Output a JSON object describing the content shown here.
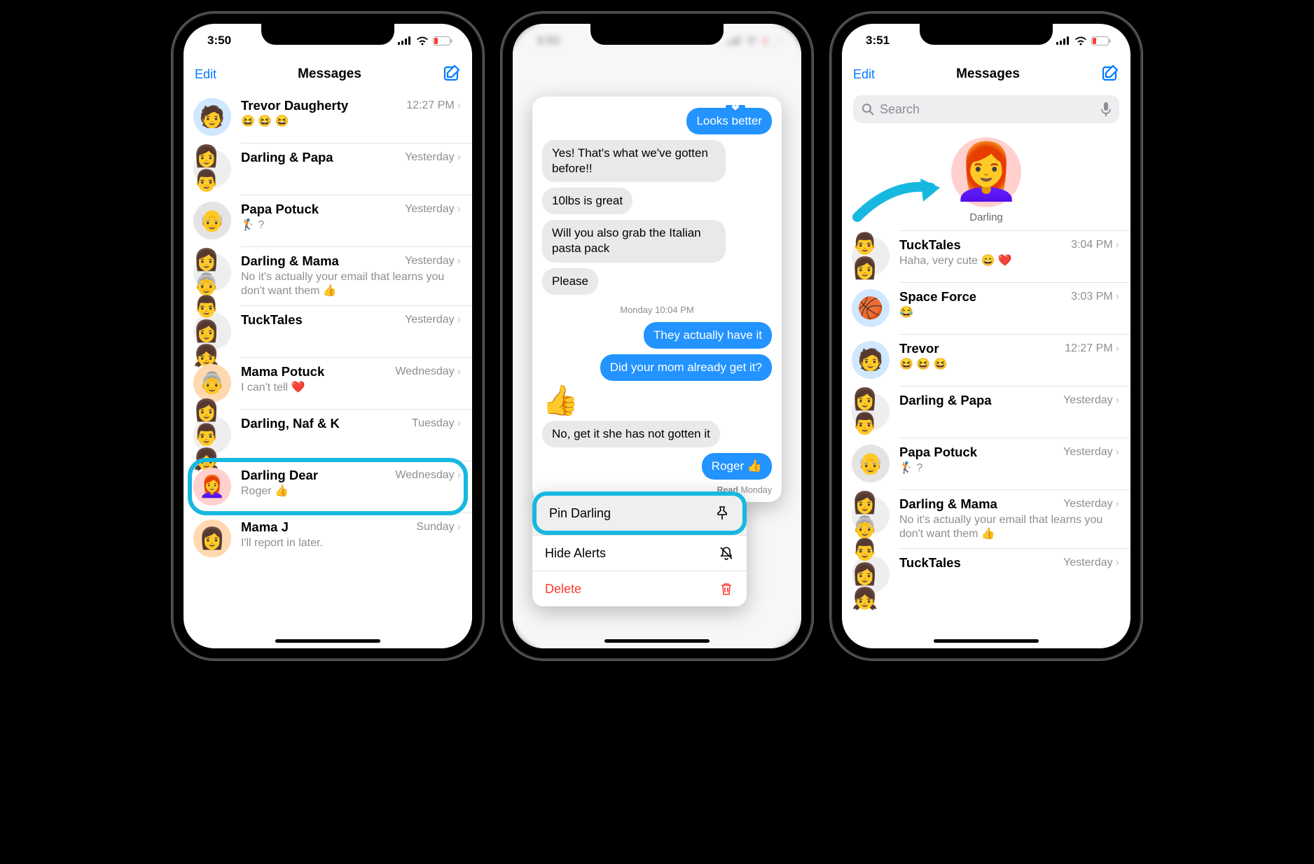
{
  "phone1": {
    "time": "3:50",
    "nav": {
      "edit": "Edit",
      "title": "Messages"
    },
    "rows": [
      {
        "name": "Trevor Daugherty",
        "time": "12:27 PM",
        "preview": "😆 😆 😆"
      },
      {
        "name": "Darling & Papa",
        "time": "Yesterday",
        "preview": ""
      },
      {
        "name": "Papa Potuck",
        "time": "Yesterday",
        "preview": "🏌️ ?"
      },
      {
        "name": "Darling & Mama",
        "time": "Yesterday",
        "preview": "No it's actually your email that learns you don't want them 👍"
      },
      {
        "name": "TuckTales",
        "time": "Yesterday",
        "preview": ""
      },
      {
        "name": "Mama Potuck",
        "time": "Wednesday",
        "preview": "I can't tell ❤️"
      },
      {
        "name": "Darling, Naf & K",
        "time": "Tuesday",
        "preview": ""
      },
      {
        "name": "Darling Dear",
        "time": "Wednesday",
        "preview": "Roger 👍"
      },
      {
        "name": "Mama J",
        "time": "Sunday",
        "preview": "I'll report in later."
      }
    ]
  },
  "phone2": {
    "time": "3:51",
    "messages": {
      "top_sent": "Looks better",
      "recv": [
        "Yes! That's what we've gotten before!!",
        "10lbs is great",
        "Will you also grab the Italian pasta pack",
        "Please"
      ],
      "tslabel": "Monday 10:04 PM",
      "sent": [
        "They actually have it",
        "Did your mom already get it?"
      ],
      "thumbs": "👍",
      "recv2": "No, get it she has not gotten it",
      "sent2": "Roger 👍",
      "read": "Read",
      "readday": "Monday"
    },
    "menu": {
      "pin": "Pin Darling",
      "hide": "Hide Alerts",
      "delete": "Delete"
    }
  },
  "phone3": {
    "time": "3:51",
    "nav": {
      "edit": "Edit",
      "title": "Messages"
    },
    "search": {
      "placeholder": "Search"
    },
    "pin": {
      "label": "Darling"
    },
    "rows": [
      {
        "name": "TuckTales",
        "time": "3:04 PM",
        "preview": "Haha, very cute 😄 ❤️"
      },
      {
        "name": "Space Force",
        "time": "3:03 PM",
        "preview": "😂"
      },
      {
        "name": "Trevor",
        "time": "12:27 PM",
        "preview": "😆 😆 😆"
      },
      {
        "name": "Darling & Papa",
        "time": "Yesterday",
        "preview": ""
      },
      {
        "name": "Papa Potuck",
        "time": "Yesterday",
        "preview": "🏌️ ?"
      },
      {
        "name": "Darling & Mama",
        "time": "Yesterday",
        "preview": "No it's actually your email that learns you don't want them 👍"
      },
      {
        "name": "TuckTales",
        "time": "Yesterday",
        "preview": ""
      }
    ]
  }
}
